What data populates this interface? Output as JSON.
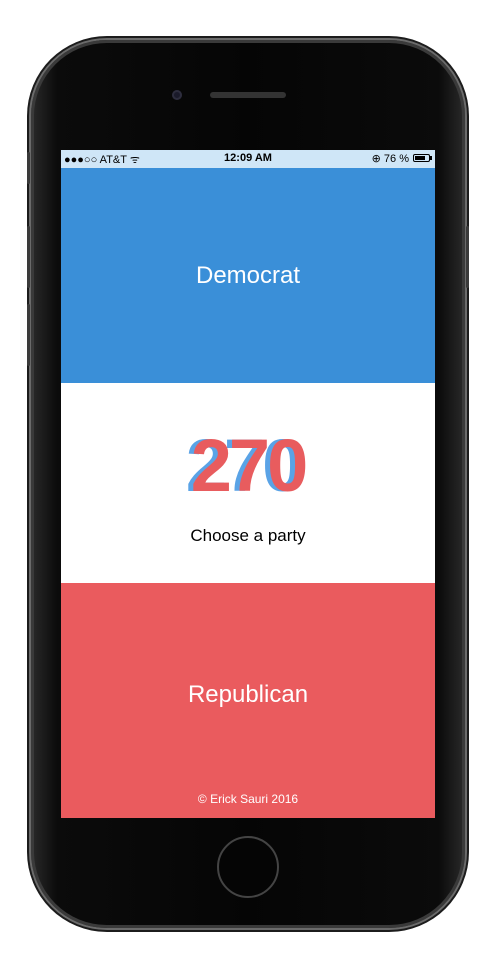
{
  "status_bar": {
    "carrier": "●●●○○ AT&T ᯤ",
    "time": "12:09 AM",
    "battery_text": "⊕ 76 %",
    "battery_level_percent": 76
  },
  "democrat": {
    "label": "Democrat",
    "color": "#3a8fd8"
  },
  "middle": {
    "logo": "270",
    "tagline": "Choose a party"
  },
  "republican": {
    "label": "Republican",
    "color": "#ea5b5e"
  },
  "footer": {
    "copyright": "© Erick Sauri 2016"
  },
  "icons": {
    "signal": "signal-dots-icon",
    "wifi": "wifi-icon",
    "rotation_lock": "rotation-lock-icon",
    "battery": "battery-icon"
  }
}
